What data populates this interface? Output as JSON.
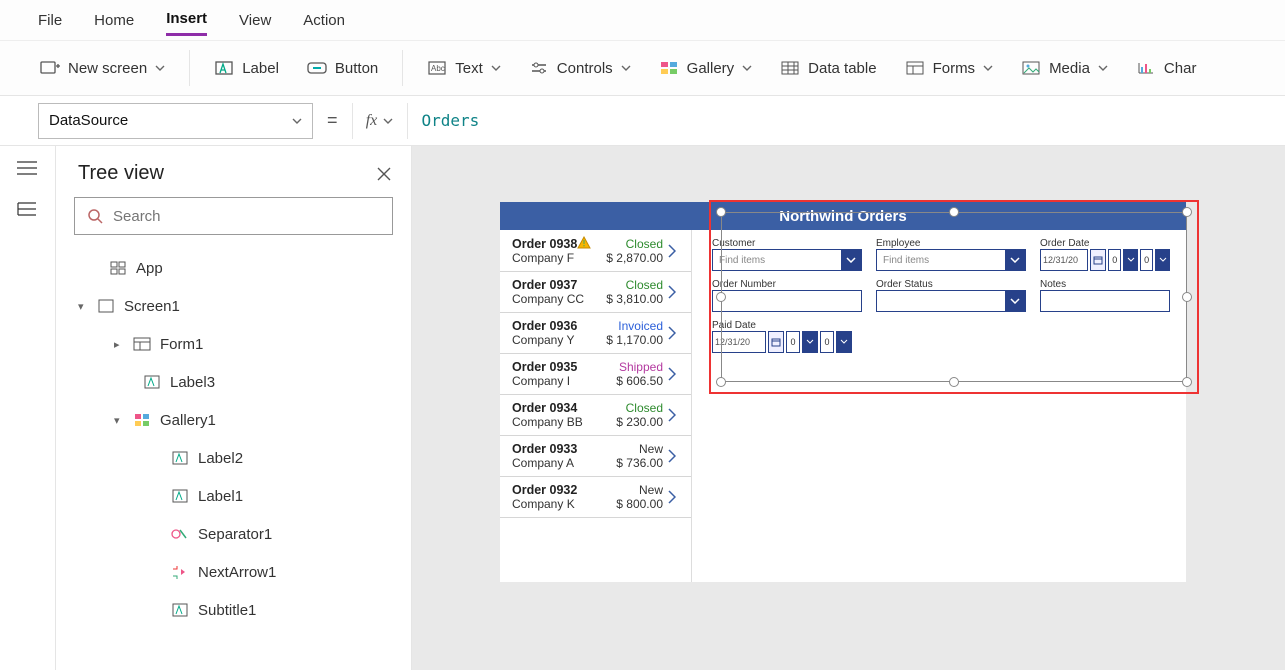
{
  "menu": {
    "items": [
      "File",
      "Home",
      "Insert",
      "View",
      "Action"
    ],
    "activeIndex": 2
  },
  "ribbon": {
    "newScreen": "New screen",
    "label": "Label",
    "button": "Button",
    "text": "Text",
    "controls": "Controls",
    "gallery": "Gallery",
    "dataTable": "Data table",
    "forms": "Forms",
    "media": "Media",
    "chart": "Char"
  },
  "formulaBar": {
    "property": "DataSource",
    "equals": "=",
    "fx": "fx",
    "value": "Orders"
  },
  "leftPanel": {
    "title": "Tree view",
    "searchPlaceholder": "Search",
    "tree": {
      "app": "App",
      "screen1": "Screen1",
      "form1": "Form1",
      "label3": "Label3",
      "gallery1": "Gallery1",
      "label2": "Label2",
      "label1": "Label1",
      "separator1": "Separator1",
      "nextArrow1": "NextArrow1",
      "subtitle1": "Subtitle1"
    }
  },
  "app": {
    "title": "Northwind Orders",
    "orders": [
      {
        "num": "Order 0938",
        "warn": true,
        "company": "Company F",
        "status": "Closed",
        "amount": "$ 2,870.00"
      },
      {
        "num": "Order 0937",
        "warn": false,
        "company": "Company CC",
        "status": "Closed",
        "amount": "$ 3,810.00"
      },
      {
        "num": "Order 0936",
        "warn": false,
        "company": "Company Y",
        "status": "Invoiced",
        "amount": "$ 1,170.00"
      },
      {
        "num": "Order 0935",
        "warn": false,
        "company": "Company I",
        "status": "Shipped",
        "amount": "$ 606.50"
      },
      {
        "num": "Order 0934",
        "warn": false,
        "company": "Company BB",
        "status": "Closed",
        "amount": "$ 230.00"
      },
      {
        "num": "Order 0933",
        "warn": false,
        "company": "Company A",
        "status": "New",
        "amount": "$ 736.00"
      },
      {
        "num": "Order 0932",
        "warn": false,
        "company": "Company K",
        "status": "New",
        "amount": "$ 800.00"
      }
    ],
    "form": {
      "customerLabel": "Customer",
      "customerPlaceholder": "Find items",
      "employeeLabel": "Employee",
      "employeePlaceholder": "Find items",
      "orderDateLabel": "Order Date",
      "orderDateValue": "12/31/20",
      "orderNumberLabel": "Order Number",
      "orderStatusLabel": "Order Status",
      "notesLabel": "Notes",
      "paidDateLabel": "Paid Date",
      "paidDateValue": "12/31/20",
      "spinDisplay": "0"
    }
  }
}
